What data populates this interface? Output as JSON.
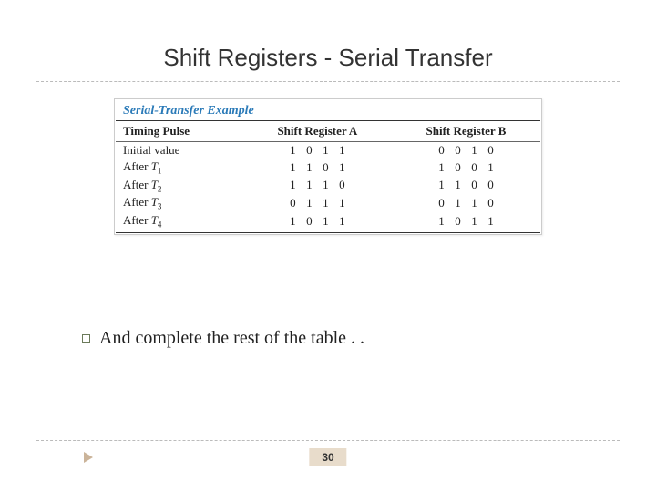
{
  "title": "Shift Registers - Serial Transfer",
  "table": {
    "caption": "Serial-Transfer Example",
    "headers": [
      "Timing Pulse",
      "Shift Register A",
      "Shift Register B"
    ],
    "rows": [
      {
        "label": "Initial value",
        "sub": "",
        "a": [
          "1",
          "0",
          "1",
          "1"
        ],
        "b": [
          "0",
          "0",
          "1",
          "0"
        ]
      },
      {
        "label": "After ",
        "sub": "T1",
        "a": [
          "1",
          "1",
          "0",
          "1"
        ],
        "b": [
          "1",
          "0",
          "0",
          "1"
        ]
      },
      {
        "label": "After ",
        "sub": "T2",
        "a": [
          "1",
          "1",
          "1",
          "0"
        ],
        "b": [
          "1",
          "1",
          "0",
          "0"
        ]
      },
      {
        "label": "After ",
        "sub": "T3",
        "a": [
          "0",
          "1",
          "1",
          "1"
        ],
        "b": [
          "0",
          "1",
          "1",
          "0"
        ]
      },
      {
        "label": "After ",
        "sub": "T4",
        "a": [
          "1",
          "0",
          "1",
          "1"
        ],
        "b": [
          "1",
          "0",
          "1",
          "1"
        ]
      }
    ]
  },
  "bullet_text": "And complete the rest of the table . .",
  "page_number": "30"
}
